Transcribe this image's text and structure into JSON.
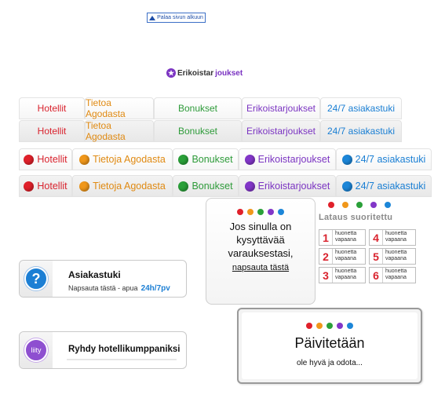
{
  "back_to_top": "Palaa sivun alkuun",
  "special_heading": {
    "part1": "Erikoistar",
    "part2": "joukset"
  },
  "tabs": [
    "Hotellit",
    "Tietoa Agodasta",
    "Bonukset",
    "Erikoistarjoukset",
    "24/7 asiakastuki"
  ],
  "tabs_dotted": [
    "Hotellit",
    "Tietoja Agodasta",
    "Bonukset",
    "Erikoistarjoukset",
    "24/7 asiakastuki"
  ],
  "colors": {
    "red": "#e0202a",
    "orange": "#f0971a",
    "green": "#2aa039",
    "purple": "#8236c8",
    "blue": "#1c86d8"
  },
  "popup_question": {
    "text_lines": [
      "Jos sinulla on",
      "kysyttävää",
      "varauksestasi,"
    ],
    "link": "napsauta tästä"
  },
  "loading": {
    "title": "Lataus suoritettu",
    "rooms": [
      {
        "num": "1",
        "l1": "huonetta",
        "l2": "vapaana"
      },
      {
        "num": "4",
        "l1": "huonetta",
        "l2": "vapaana"
      },
      {
        "num": "2",
        "l1": "huonetta",
        "l2": "vapaana"
      },
      {
        "num": "5",
        "l1": "huonetta",
        "l2": "vapaana"
      },
      {
        "num": "3",
        "l1": "huonetta",
        "l2": "vapaana"
      },
      {
        "num": "6",
        "l1": "huonetta",
        "l2": "vapaana"
      }
    ]
  },
  "support": {
    "title": "Asiakastuki",
    "subtitle": "Napsauta tästä - apua",
    "hours": "24h/7pv",
    "icon": "question-icon"
  },
  "join": {
    "icon_label": "liity",
    "text": "Ryhdy hotellikumppaniksi"
  },
  "updating": {
    "title": "Päivitetään",
    "subtitle": "ole hyvä ja odota..."
  }
}
